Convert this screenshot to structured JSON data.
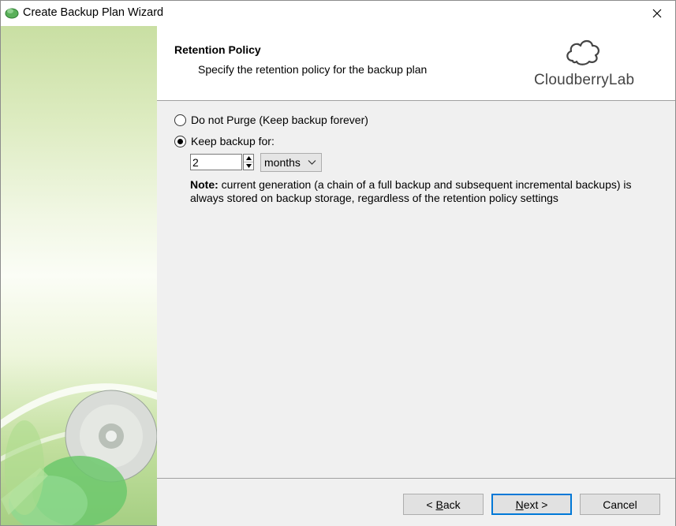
{
  "window": {
    "title": "Create Backup Plan Wizard"
  },
  "header": {
    "title": "Retention Policy",
    "subtitle": "Specify the retention policy for the backup plan",
    "logo_text": "CloudberryLab"
  },
  "options": {
    "do_not_purge_label": "Do not Purge (Keep backup forever)",
    "keep_backup_label": "Keep backup for:",
    "selected": "keep_backup"
  },
  "keep": {
    "value": "2",
    "unit": "months"
  },
  "note": {
    "label": "Note:",
    "text": " current generation (a chain of a full backup and subsequent incremental backups) is always stored on backup storage, regardless of the retention policy settings"
  },
  "footer": {
    "back_prefix": "< ",
    "back_mnemonic": "B",
    "back_rest": "ack",
    "next_mnemonic": "N",
    "next_rest": "ext >",
    "cancel_label": "Cancel"
  },
  "colors": {
    "accent": "#0078d7",
    "dialog_bg": "#f0f0f0"
  },
  "icons": {
    "app": "cloud-app-icon",
    "close": "close-icon",
    "logo": "cloud-logo-icon"
  }
}
